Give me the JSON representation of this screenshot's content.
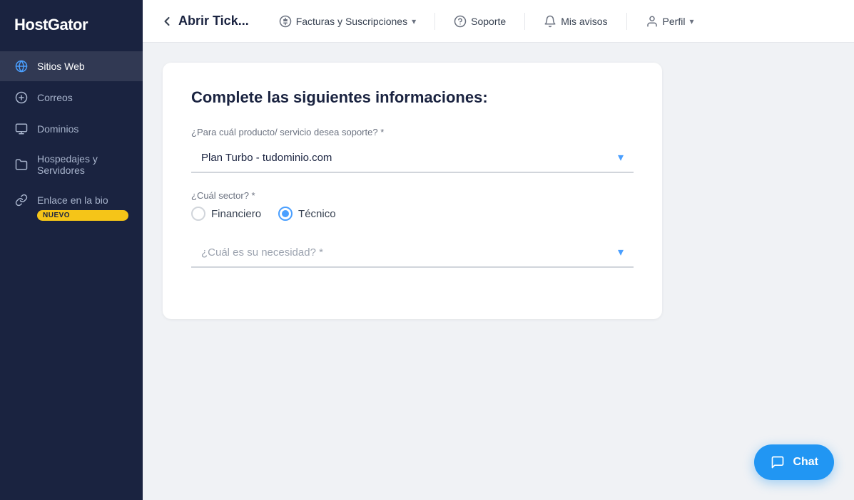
{
  "sidebar": {
    "logo": "HostGator",
    "items": [
      {
        "id": "sitios-web",
        "label": "Sitios Web",
        "icon": "globe",
        "active": true
      },
      {
        "id": "correos",
        "label": "Correos",
        "icon": "mail",
        "active": false
      },
      {
        "id": "dominios",
        "label": "Dominios",
        "icon": "monitor",
        "active": false
      },
      {
        "id": "hospedajes",
        "label": "Hospedajes y Servidores",
        "icon": "folder",
        "active": false
      },
      {
        "id": "enlace",
        "label": "Enlace en la bio",
        "icon": "link",
        "badge": "NUEVO",
        "active": false
      }
    ]
  },
  "topbar": {
    "back_label": "←",
    "title": "Abrir Tick...",
    "nav_items": [
      {
        "id": "facturas",
        "icon": "dollar",
        "label": "Facturas y Suscripciones",
        "has_chevron": true
      },
      {
        "id": "soporte",
        "icon": "question",
        "label": "Soporte",
        "has_chevron": false
      },
      {
        "id": "avisos",
        "icon": "bell",
        "label": "Mis avisos",
        "has_chevron": false
      },
      {
        "id": "perfil",
        "icon": "user",
        "label": "Perfil",
        "has_chevron": true
      }
    ]
  },
  "form": {
    "title": "Complete las siguientes informaciones:",
    "product_label": "¿Para cuál producto/ servicio desea soporte? *",
    "product_value": "Plan Turbo - tudominio.com",
    "sector_label": "¿Cuál sector? *",
    "sector_options": [
      {
        "id": "financiero",
        "label": "Financiero",
        "checked": false
      },
      {
        "id": "tecnico",
        "label": "Técnico",
        "checked": true
      }
    ],
    "need_label": "¿Cuál es su necesidad? *",
    "need_placeholder": "¿Cuál es su necesidad? *"
  },
  "chat": {
    "label": "Chat"
  }
}
